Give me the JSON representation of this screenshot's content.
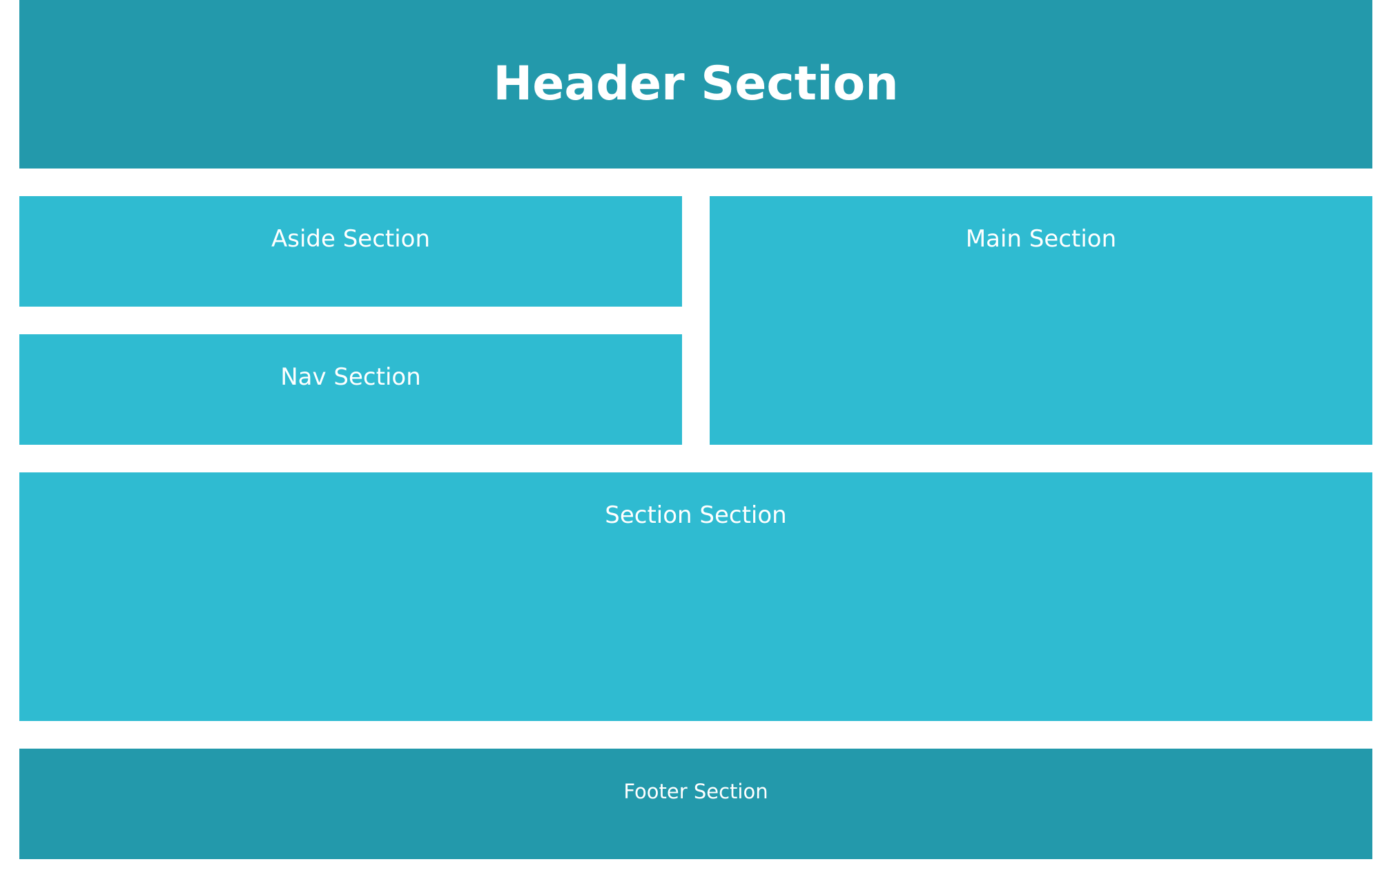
{
  "header": {
    "title": "Header Section"
  },
  "aside": {
    "label": "Aside Section"
  },
  "nav": {
    "label": "Nav Section"
  },
  "main": {
    "label": "Main Section"
  },
  "section": {
    "label": "Section Section"
  },
  "footer": {
    "label": "Footer Section"
  },
  "colors": {
    "dark_teal": "#2399ab",
    "light_teal": "#2fbbd1",
    "text": "#ffffff",
    "background": "#ffffff"
  }
}
